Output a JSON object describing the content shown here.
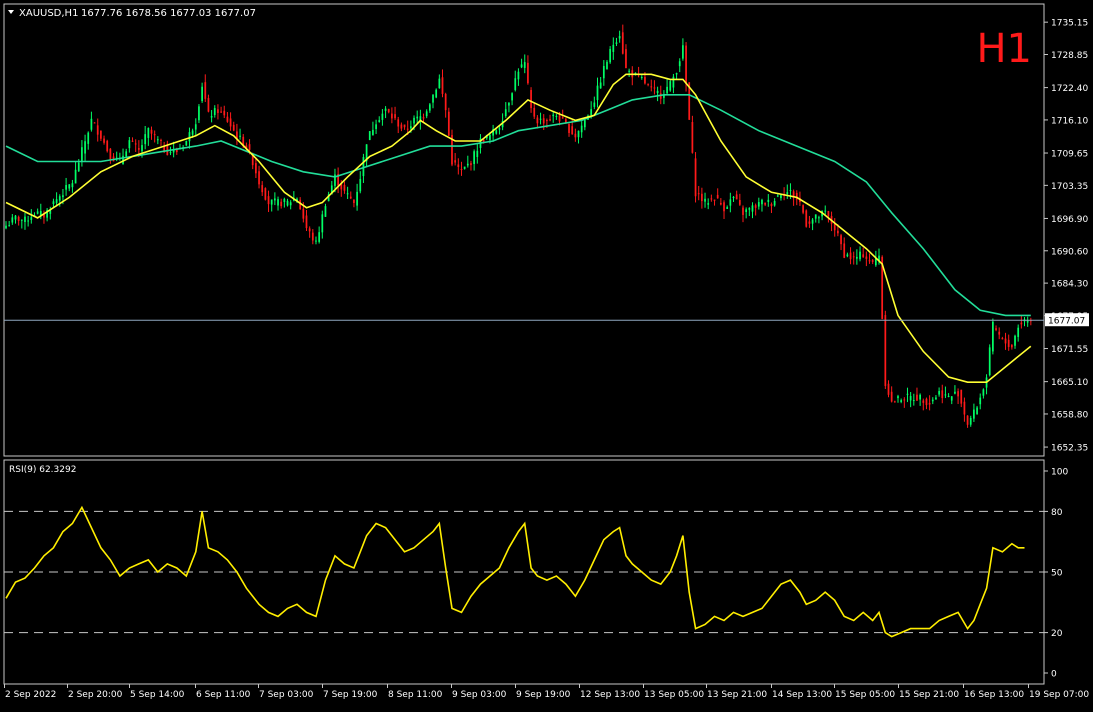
{
  "header": {
    "symbol": "XAUUSD,H1",
    "ohlc": "1677.76 1678.56 1677.03 1677.07",
    "timeframe_badge": "H1"
  },
  "indicator": {
    "label": "RSI(9) 62.3292"
  },
  "colors": {
    "background": "#000000",
    "frame": "#c8c8c8",
    "text": "#ffffff",
    "bull": "#00ff66",
    "bear": "#ff1a1a",
    "ma_fast": "#ffff33",
    "ma_slow": "#22dd99",
    "rsi": "#ffee00",
    "price_line": "#8fa8c0",
    "badge": "#ff1a1a"
  },
  "chart_data": [
    {
      "type": "candlestick",
      "symbol": "XAUUSD",
      "timeframe": "H1",
      "ylim": [
        1651.0,
        1738.3
      ],
      "price_ticks": [
        "1735.15",
        "1728.85",
        "1722.40",
        "1716.10",
        "1709.65",
        "1703.35",
        "1696.90",
        "1690.60",
        "1684.30",
        "1677.95",
        "1671.55",
        "1665.10",
        "1658.80",
        "1652.35"
      ],
      "current_price": "1677.07",
      "time_ticks": [
        "2 Sep 2022",
        "2 Sep 20:00",
        "5 Sep 14:00",
        "6 Sep 11:00",
        "7 Sep 03:00",
        "7 Sep 19:00",
        "8 Sep 11:00",
        "9 Sep 03:00",
        "9 Sep 19:00",
        "12 Sep 13:00",
        "13 Sep 05:00",
        "13 Sep 21:00",
        "14 Sep 13:00",
        "15 Sep 05:00",
        "15 Sep 21:00",
        "16 Sep 13:00",
        "19 Sep 07:00"
      ],
      "close_path": [
        [
          0,
          1695.5
        ],
        [
          3,
          1697
        ],
        [
          6,
          1696.5
        ],
        [
          9,
          1698
        ],
        [
          12,
          1697.5
        ],
        [
          15,
          1700
        ],
        [
          18,
          1702
        ],
        [
          21,
          1704
        ],
        [
          24,
          1710
        ],
        [
          27,
          1716
        ],
        [
          30,
          1713
        ],
        [
          33,
          1709
        ],
        [
          36,
          1708
        ],
        [
          39,
          1712
        ],
        [
          42,
          1710
        ],
        [
          45,
          1714
        ],
        [
          48,
          1712
        ],
        [
          51,
          1710
        ],
        [
          54,
          1710
        ],
        [
          57,
          1712
        ],
        [
          60,
          1716
        ],
        [
          62,
          1723
        ],
        [
          64,
          1717
        ],
        [
          67,
          1718
        ],
        [
          70,
          1716
        ],
        [
          73,
          1713
        ],
        [
          76,
          1711
        ],
        [
          78,
          1708
        ],
        [
          80,
          1704
        ],
        [
          83,
          1700
        ],
        [
          86,
          1700
        ],
        [
          89,
          1700
        ],
        [
          92,
          1701
        ],
        [
          95,
          1695
        ],
        [
          98,
          1692
        ],
        [
          101,
          1700
        ],
        [
          104,
          1705
        ],
        [
          107,
          1702
        ],
        [
          110,
          1700
        ],
        [
          112,
          1705
        ],
        [
          114,
          1712
        ],
        [
          117,
          1716
        ],
        [
          120,
          1718
        ],
        [
          123,
          1716
        ],
        [
          126,
          1714
        ],
        [
          129,
          1716
        ],
        [
          132,
          1717
        ],
        [
          135,
          1721
        ],
        [
          137,
          1724
        ],
        [
          139,
          1718
        ],
        [
          141,
          1708
        ],
        [
          144,
          1706
        ],
        [
          147,
          1708
        ],
        [
          150,
          1712
        ],
        [
          153,
          1713
        ],
        [
          156,
          1715
        ],
        [
          159,
          1720
        ],
        [
          162,
          1726
        ],
        [
          164,
          1727
        ],
        [
          166,
          1718
        ],
        [
          168,
          1716
        ],
        [
          171,
          1716
        ],
        [
          174,
          1717
        ],
        [
          177,
          1715
        ],
        [
          180,
          1713
        ],
        [
          183,
          1716
        ],
        [
          186,
          1720
        ],
        [
          189,
          1726
        ],
        [
          192,
          1731
        ],
        [
          194,
          1733
        ],
        [
          196,
          1726
        ],
        [
          198,
          1725
        ],
        [
          201,
          1724
        ],
        [
          204,
          1722
        ],
        [
          207,
          1721
        ],
        [
          210,
          1723
        ],
        [
          212,
          1726
        ],
        [
          214,
          1730
        ],
        [
          216,
          1716
        ],
        [
          218,
          1702
        ],
        [
          221,
          1700
        ],
        [
          224,
          1701
        ],
        [
          227,
          1699
        ],
        [
          230,
          1701
        ],
        [
          233,
          1698
        ],
        [
          236,
          1699
        ],
        [
          239,
          1700
        ],
        [
          242,
          1700
        ],
        [
          245,
          1702
        ],
        [
          248,
          1702
        ],
        [
          251,
          1700
        ],
        [
          253,
          1696
        ],
        [
          256,
          1697
        ],
        [
          259,
          1698
        ],
        [
          262,
          1695
        ],
        [
          265,
          1690
        ],
        [
          268,
          1689
        ],
        [
          271,
          1690
        ],
        [
          274,
          1688
        ],
        [
          276,
          1690
        ],
        [
          278,
          1665
        ],
        [
          280,
          1661
        ],
        [
          283,
          1662
        ],
        [
          286,
          1662
        ],
        [
          289,
          1662
        ],
        [
          292,
          1661
        ],
        [
          295,
          1663
        ],
        [
          298,
          1662
        ],
        [
          301,
          1663
        ],
        [
          304,
          1657
        ],
        [
          306,
          1659
        ],
        [
          308,
          1662
        ],
        [
          310,
          1666
        ],
        [
          312,
          1676
        ],
        [
          315,
          1673
        ],
        [
          318,
          1672
        ],
        [
          320,
          1676
        ],
        [
          322,
          1677.07
        ]
      ],
      "ma_fast_path": [
        [
          0,
          1700
        ],
        [
          10,
          1697
        ],
        [
          20,
          1701
        ],
        [
          30,
          1706
        ],
        [
          40,
          1709
        ],
        [
          50,
          1711
        ],
        [
          60,
          1713
        ],
        [
          66,
          1715
        ],
        [
          72,
          1713
        ],
        [
          80,
          1708
        ],
        [
          88,
          1702
        ],
        [
          95,
          1699
        ],
        [
          100,
          1700
        ],
        [
          108,
          1705
        ],
        [
          115,
          1709
        ],
        [
          122,
          1711
        ],
        [
          128,
          1714
        ],
        [
          131,
          1716
        ],
        [
          136,
          1714
        ],
        [
          142,
          1712
        ],
        [
          150,
          1712
        ],
        [
          158,
          1716
        ],
        [
          165,
          1720
        ],
        [
          172,
          1718
        ],
        [
          180,
          1716
        ],
        [
          186,
          1717
        ],
        [
          192,
          1723
        ],
        [
          196,
          1725
        ],
        [
          204,
          1725
        ],
        [
          210,
          1724
        ],
        [
          214,
          1724
        ],
        [
          218,
          1721
        ],
        [
          226,
          1712
        ],
        [
          234,
          1705
        ],
        [
          242,
          1702
        ],
        [
          250,
          1701
        ],
        [
          258,
          1698
        ],
        [
          264,
          1695
        ],
        [
          272,
          1691
        ],
        [
          277,
          1688
        ],
        [
          282,
          1678
        ],
        [
          290,
          1671
        ],
        [
          298,
          1666
        ],
        [
          304,
          1665
        ],
        [
          310,
          1665
        ],
        [
          318,
          1669
        ],
        [
          324,
          1672
        ]
      ],
      "ma_slow_path": [
        [
          0,
          1711
        ],
        [
          10,
          1708
        ],
        [
          20,
          1708
        ],
        [
          30,
          1708
        ],
        [
          40,
          1709
        ],
        [
          50,
          1710
        ],
        [
          60,
          1711
        ],
        [
          68,
          1712
        ],
        [
          76,
          1710
        ],
        [
          84,
          1708
        ],
        [
          94,
          1706
        ],
        [
          104,
          1705
        ],
        [
          114,
          1707
        ],
        [
          124,
          1709
        ],
        [
          134,
          1711
        ],
        [
          144,
          1711
        ],
        [
          154,
          1712
        ],
        [
          162,
          1714
        ],
        [
          172,
          1715
        ],
        [
          182,
          1716
        ],
        [
          190,
          1718
        ],
        [
          198,
          1720
        ],
        [
          208,
          1721
        ],
        [
          216,
          1721
        ],
        [
          226,
          1718
        ],
        [
          238,
          1714
        ],
        [
          250,
          1711
        ],
        [
          262,
          1708
        ],
        [
          272,
          1704
        ],
        [
          280,
          1698
        ],
        [
          290,
          1691
        ],
        [
          300,
          1683
        ],
        [
          308,
          1679
        ],
        [
          316,
          1678
        ],
        [
          324,
          1678
        ]
      ]
    },
    {
      "type": "line",
      "name": "RSI(9) 62.3292",
      "ylim": [
        0,
        100
      ],
      "y_ticks": [
        "100",
        "80",
        "50",
        "20",
        "0"
      ],
      "levels": [
        80,
        50,
        20
      ],
      "values": [
        [
          0,
          37
        ],
        [
          3,
          45
        ],
        [
          6,
          47
        ],
        [
          9,
          52
        ],
        [
          12,
          58
        ],
        [
          15,
          62
        ],
        [
          18,
          70
        ],
        [
          21,
          74
        ],
        [
          24,
          82
        ],
        [
          27,
          72
        ],
        [
          30,
          62
        ],
        [
          33,
          56
        ],
        [
          36,
          48
        ],
        [
          39,
          52
        ],
        [
          42,
          54
        ],
        [
          45,
          56
        ],
        [
          48,
          50
        ],
        [
          51,
          54
        ],
        [
          54,
          52
        ],
        [
          57,
          48
        ],
        [
          60,
          60
        ],
        [
          62,
          80
        ],
        [
          64,
          62
        ],
        [
          67,
          60
        ],
        [
          70,
          56
        ],
        [
          73,
          50
        ],
        [
          76,
          42
        ],
        [
          78,
          38
        ],
        [
          80,
          34
        ],
        [
          83,
          30
        ],
        [
          86,
          28
        ],
        [
          89,
          32
        ],
        [
          92,
          34
        ],
        [
          95,
          30
        ],
        [
          98,
          28
        ],
        [
          101,
          46
        ],
        [
          104,
          58
        ],
        [
          107,
          54
        ],
        [
          110,
          52
        ],
        [
          112,
          60
        ],
        [
          114,
          68
        ],
        [
          117,
          74
        ],
        [
          120,
          72
        ],
        [
          123,
          66
        ],
        [
          126,
          60
        ],
        [
          129,
          62
        ],
        [
          132,
          66
        ],
        [
          135,
          70
        ],
        [
          137,
          74
        ],
        [
          139,
          52
        ],
        [
          141,
          32
        ],
        [
          144,
          30
        ],
        [
          147,
          38
        ],
        [
          150,
          44
        ],
        [
          153,
          48
        ],
        [
          156,
          52
        ],
        [
          159,
          62
        ],
        [
          162,
          70
        ],
        [
          164,
          74
        ],
        [
          166,
          52
        ],
        [
          168,
          48
        ],
        [
          171,
          46
        ],
        [
          174,
          48
        ],
        [
          177,
          44
        ],
        [
          180,
          38
        ],
        [
          183,
          46
        ],
        [
          186,
          56
        ],
        [
          189,
          66
        ],
        [
          192,
          70
        ],
        [
          194,
          72
        ],
        [
          196,
          58
        ],
        [
          198,
          54
        ],
        [
          201,
          50
        ],
        [
          204,
          46
        ],
        [
          207,
          44
        ],
        [
          210,
          50
        ],
        [
          212,
          58
        ],
        [
          214,
          68
        ],
        [
          216,
          40
        ],
        [
          218,
          22
        ],
        [
          221,
          24
        ],
        [
          224,
          28
        ],
        [
          227,
          26
        ],
        [
          230,
          30
        ],
        [
          233,
          28
        ],
        [
          236,
          30
        ],
        [
          239,
          32
        ],
        [
          242,
          38
        ],
        [
          245,
          44
        ],
        [
          248,
          46
        ],
        [
          251,
          40
        ],
        [
          253,
          34
        ],
        [
          256,
          36
        ],
        [
          259,
          40
        ],
        [
          262,
          36
        ],
        [
          265,
          28
        ],
        [
          268,
          26
        ],
        [
          271,
          30
        ],
        [
          274,
          26
        ],
        [
          276,
          30
        ],
        [
          278,
          20
        ],
        [
          280,
          18
        ],
        [
          283,
          20
        ],
        [
          286,
          22
        ],
        [
          289,
          22
        ],
        [
          292,
          22
        ],
        [
          295,
          26
        ],
        [
          298,
          28
        ],
        [
          301,
          30
        ],
        [
          304,
          22
        ],
        [
          306,
          26
        ],
        [
          308,
          34
        ],
        [
          310,
          42
        ],
        [
          312,
          62
        ],
        [
          315,
          60
        ],
        [
          318,
          64
        ],
        [
          320,
          62
        ],
        [
          322,
          62
        ]
      ]
    }
  ]
}
